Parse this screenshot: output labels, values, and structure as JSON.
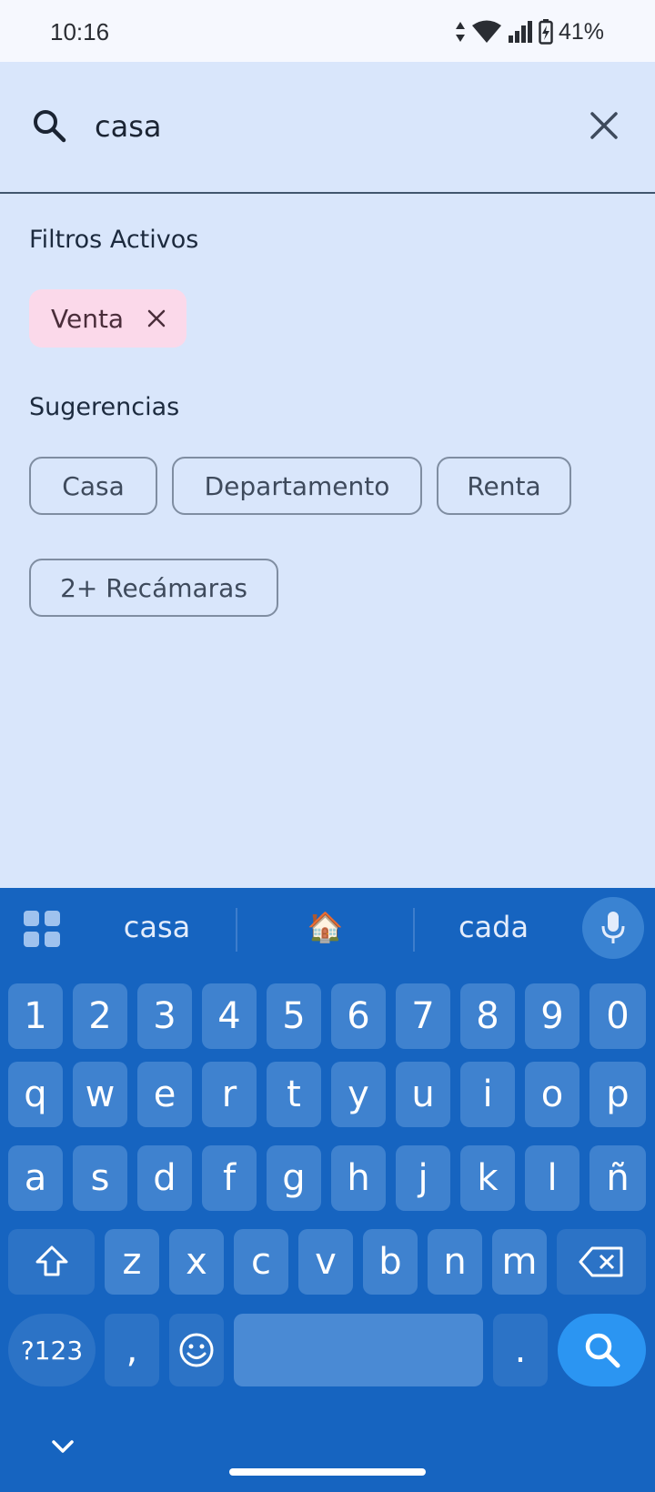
{
  "status_bar": {
    "time": "10:16",
    "battery": "41%"
  },
  "search": {
    "query": "casa"
  },
  "active_filters": {
    "title": "Filtros Activos",
    "chips": [
      {
        "label": "Venta"
      }
    ]
  },
  "suggestions": {
    "title": "Sugerencias",
    "chips": [
      {
        "label": "Casa"
      },
      {
        "label": "Departamento"
      },
      {
        "label": "Renta"
      },
      {
        "label": "2+ Recámaras"
      }
    ]
  },
  "keyboard": {
    "suggestions": [
      "casa",
      "🏠",
      "cada"
    ],
    "row_numbers": [
      "1",
      "2",
      "3",
      "4",
      "5",
      "6",
      "7",
      "8",
      "9",
      "0"
    ],
    "row_1": [
      "q",
      "w",
      "e",
      "r",
      "t",
      "y",
      "u",
      "i",
      "o",
      "p"
    ],
    "row_2": [
      "a",
      "s",
      "d",
      "f",
      "g",
      "h",
      "j",
      "k",
      "l",
      "ñ"
    ],
    "row_3": [
      "z",
      "x",
      "c",
      "v",
      "b",
      "n",
      "m"
    ],
    "symbols_label": "?123",
    "comma": ",",
    "period": "."
  },
  "colors": {
    "background": "#d9e6fb",
    "keyboard": "#1664c0",
    "active_chip": "#fbd9ea",
    "search_key": "#2b95f2"
  }
}
